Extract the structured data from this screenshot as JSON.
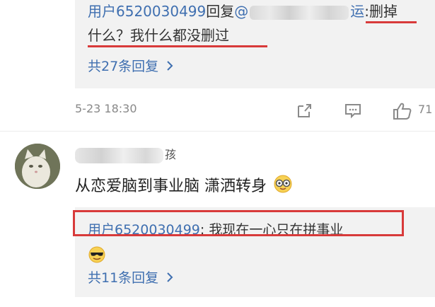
{
  "top_reply": {
    "user": "用户6520030499",
    "reply_word": "回复",
    "at_prefix": "@",
    "mention_suffix": "运",
    "text_part1": ":删掉",
    "text_part2": "什么？我什么都没删过",
    "more_replies": "共27条回复",
    "chevron": "chevron-right-icon"
  },
  "meta": {
    "time": "5-23 18:30",
    "share_icon": "share-icon",
    "comment_icon": "comment-icon",
    "like_icon": "thumbs-up-icon",
    "like_count": "71"
  },
  "comment": {
    "username_visible_suffix": "孩",
    "text": "从恋爱脑到事业脑 潇洒转身",
    "emoji": "nerd-glasses-emoji",
    "avatar": "cat-avatar"
  },
  "bottom_reply": {
    "user": "用户6520030499",
    "text": ": 我现在一心只在拼事业",
    "emoji": "sunglasses-emoji",
    "more_replies": "共11条回复",
    "chevron": "chevron-right-icon"
  },
  "colors": {
    "link": "#3f6fb0",
    "highlight": "#d83a3a",
    "reply_bg": "#f2f2f2"
  }
}
